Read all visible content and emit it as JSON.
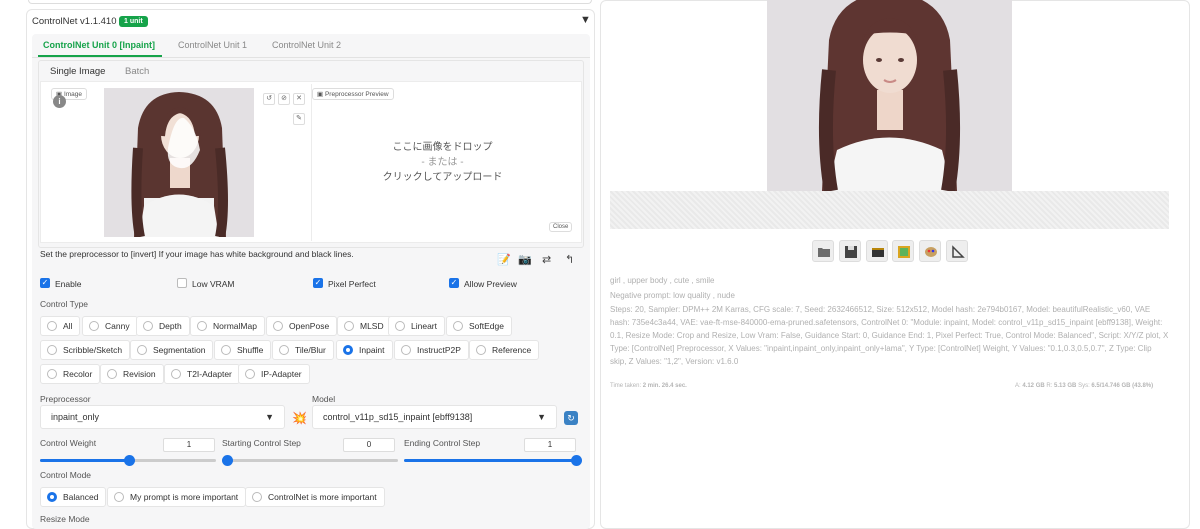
{
  "controlnet": {
    "title": "ControlNet v1.1.410",
    "badge": "1 unit",
    "collapse_icon": "triangle-down-icon",
    "units": [
      "ControlNet Unit 0 [Inpaint]",
      "ControlNet Unit 1",
      "ControlNet Unit 2"
    ],
    "image_tabs": [
      "Single Image",
      "Batch"
    ],
    "image_label": "Image",
    "preview_label": "Preprocessor Preview",
    "drop_line1": "ここに画像をドロップ",
    "drop_or": "- または -",
    "drop_line2": "クリックしてアップロード",
    "close_label": "Close",
    "hint": "Set the preprocessor to [invert] If your image has white background and black lines.",
    "checkboxes": [
      {
        "label": "Enable",
        "checked": true
      },
      {
        "label": "Low VRAM",
        "checked": false
      },
      {
        "label": "Pixel Perfect",
        "checked": true
      },
      {
        "label": "Allow Preview",
        "checked": true
      }
    ],
    "control_type_label": "Control Type",
    "control_types": [
      "All",
      "Canny",
      "Depth",
      "NormalMap",
      "OpenPose",
      "MLSD",
      "Lineart",
      "SoftEdge",
      "Scribble/Sketch",
      "Segmentation",
      "Shuffle",
      "Tile/Blur",
      "Inpaint",
      "InstructP2P",
      "Reference",
      "Recolor",
      "Revision",
      "T2I-Adapter",
      "IP-Adapter"
    ],
    "selected_control_type": "Inpaint",
    "preprocessor_label": "Preprocessor",
    "preprocessor_value": "inpaint_only",
    "model_label": "Model",
    "model_value": "control_v11p_sd15_inpaint [ebff9138]",
    "weight_label": "Control Weight",
    "weight_value": "1",
    "start_label": "Starting Control Step",
    "start_value": "0",
    "end_label": "Ending Control Step",
    "end_value": "1",
    "control_mode_label": "Control Mode",
    "control_modes": [
      "Balanced",
      "My prompt is more important",
      "ControlNet is more important"
    ],
    "selected_control_mode": "Balanced",
    "resize_mode_label": "Resize Mode"
  },
  "output": {
    "prompt": "girl , upper body , cute , smile",
    "negative": "Negative prompt: low quality , nude",
    "params": "Steps: 20, Sampler: DPM++ 2M Karras, CFG scale: 7, Seed: 2632466512, Size: 512x512, Model hash: 2e794b0167, Model: beautifulRealistic_v60, VAE hash: 735e4c3a44, VAE: vae-ft-mse-840000-ema-pruned.safetensors, ControlNet 0: \"Module: inpaint, Model: control_v11p_sd15_inpaint [ebff9138], Weight: 0.1, Resize Mode: Crop and Resize, Low Vram: False, Guidance Start: 0, Guidance End: 1, Pixel Perfect: True, Control Mode: Balanced\", Script: X/Y/Z plot, X Type: [ControlNet] Preprocessor, X Values: \"inpaint,inpaint_only,inpaint_only+lama\", Y Type: [ControlNet] Weight, Y Values: \"0.1,0.3,0.5,0.7\", Z Type: Clip skip, Z Values: \"1,2\", Version: v1.6.0",
    "time_label": "Time taken:",
    "time_value": "2 min. 26.4 sec.",
    "mem_a_label": "A:",
    "mem_a": "4.12 GB",
    "mem_r_label": "R:",
    "mem_r": "5.13 GB",
    "mem_sys_label": "Sys:",
    "mem_sys": "6.5/14.746 GB (43.8%)",
    "tools": [
      "folder-icon",
      "save-icon",
      "zip-icon",
      "image-icon",
      "palette-icon",
      "ruler-icon"
    ]
  }
}
